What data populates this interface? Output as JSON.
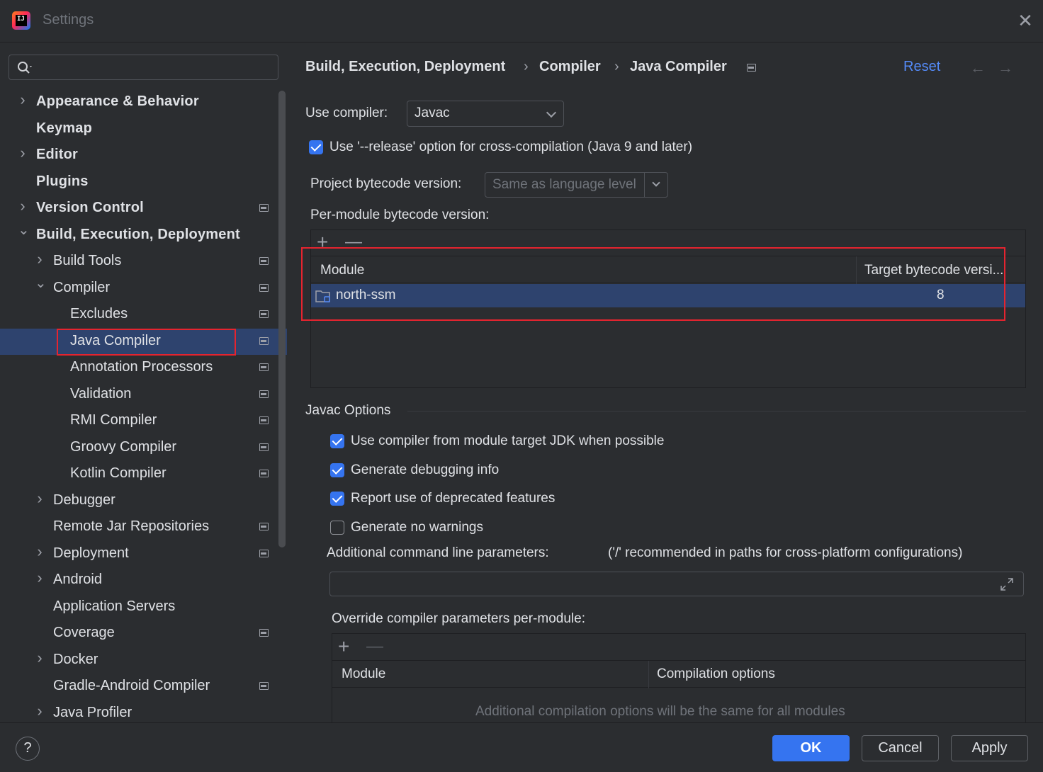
{
  "window": {
    "title": "Settings",
    "close_icon": "close-icon"
  },
  "search": {
    "placeholder": ""
  },
  "tree": [
    {
      "label": "Appearance & Behavior",
      "level": 0,
      "arrow": "right",
      "bold": true,
      "proj": false
    },
    {
      "label": "Keymap",
      "level": 0,
      "arrow": "",
      "bold": true,
      "proj": false
    },
    {
      "label": "Editor",
      "level": 0,
      "arrow": "right",
      "bold": true,
      "proj": false
    },
    {
      "label": "Plugins",
      "level": 0,
      "arrow": "",
      "bold": true,
      "proj": false
    },
    {
      "label": "Version Control",
      "level": 0,
      "arrow": "right",
      "bold": true,
      "proj": true
    },
    {
      "label": "Build, Execution, Deployment",
      "level": 0,
      "arrow": "down",
      "bold": true,
      "proj": false
    },
    {
      "label": "Build Tools",
      "level": 1,
      "arrow": "right",
      "bold": false,
      "proj": true
    },
    {
      "label": "Compiler",
      "level": 1,
      "arrow": "down",
      "bold": false,
      "proj": true
    },
    {
      "label": "Excludes",
      "level": 2,
      "arrow": "",
      "bold": false,
      "proj": true
    },
    {
      "label": "Java Compiler",
      "level": 2,
      "arrow": "",
      "bold": false,
      "proj": true,
      "selected": true
    },
    {
      "label": "Annotation Processors",
      "level": 2,
      "arrow": "",
      "bold": false,
      "proj": true
    },
    {
      "label": "Validation",
      "level": 2,
      "arrow": "",
      "bold": false,
      "proj": true
    },
    {
      "label": "RMI Compiler",
      "level": 2,
      "arrow": "",
      "bold": false,
      "proj": true
    },
    {
      "label": "Groovy Compiler",
      "level": 2,
      "arrow": "",
      "bold": false,
      "proj": true
    },
    {
      "label": "Kotlin Compiler",
      "level": 2,
      "arrow": "",
      "bold": false,
      "proj": true
    },
    {
      "label": "Debugger",
      "level": 1,
      "arrow": "right",
      "bold": false,
      "proj": false
    },
    {
      "label": "Remote Jar Repositories",
      "level": 1,
      "arrow": "",
      "bold": false,
      "proj": true
    },
    {
      "label": "Deployment",
      "level": 1,
      "arrow": "right",
      "bold": false,
      "proj": true
    },
    {
      "label": "Android",
      "level": 1,
      "arrow": "right",
      "bold": false,
      "proj": false
    },
    {
      "label": "Application Servers",
      "level": 1,
      "arrow": "",
      "bold": false,
      "proj": false
    },
    {
      "label": "Coverage",
      "level": 1,
      "arrow": "",
      "bold": false,
      "proj": true
    },
    {
      "label": "Docker",
      "level": 1,
      "arrow": "right",
      "bold": false,
      "proj": false
    },
    {
      "label": "Gradle-Android Compiler",
      "level": 1,
      "arrow": "",
      "bold": false,
      "proj": true
    },
    {
      "label": "Java Profiler",
      "level": 1,
      "arrow": "right",
      "bold": false,
      "proj": false
    }
  ],
  "breadcrumb": {
    "items": [
      "Build, Execution, Deployment",
      "Compiler",
      "Java Compiler"
    ],
    "separator": "›",
    "reset": "Reset",
    "back": "←",
    "forward": "→"
  },
  "compiler": {
    "use_compiler_label": "Use compiler:",
    "use_compiler_value": "Javac",
    "release_option": {
      "label": "Use '--release' option for cross-compilation (Java 9 and later)",
      "checked": true
    },
    "project_bytecode_label": "Project bytecode version:",
    "project_bytecode_placeholder": "Same as language level",
    "per_module_label": "Per-module bytecode version:",
    "module_table": {
      "add": "+",
      "remove": "—",
      "columns": [
        "Module",
        "Target bytecode versi..."
      ],
      "rows": [
        {
          "module": "north-ssm",
          "target": "8"
        }
      ]
    }
  },
  "javac": {
    "section_title": "Javac Options",
    "options": [
      {
        "label": "Use compiler from module target JDK when possible",
        "checked": true
      },
      {
        "label": "Generate debugging info",
        "checked": true
      },
      {
        "label": "Report use of deprecated features",
        "checked": true
      },
      {
        "label": "Generate no warnings",
        "checked": false
      }
    ],
    "additional_params_label": "Additional command line parameters:",
    "additional_params_hint": "('/' recommended in paths for cross-platform configurations)",
    "additional_params_value": "",
    "override_label": "Override compiler parameters per-module:",
    "override_table": {
      "add": "+",
      "remove": "—",
      "columns": [
        "Module",
        "Compilation options"
      ],
      "empty_text": "Additional compilation options will be the same for all modules"
    }
  },
  "footer": {
    "help": "?",
    "ok": "OK",
    "cancel": "Cancel",
    "apply": "Apply"
  },
  "colors": {
    "accent": "#3574f0",
    "selection": "#2e436e",
    "highlight": "#e5242f",
    "link": "#548af7"
  }
}
